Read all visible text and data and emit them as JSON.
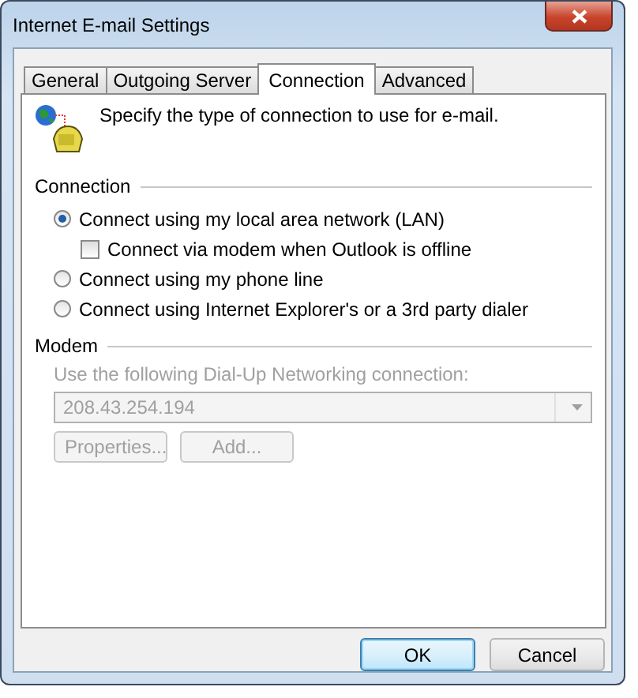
{
  "window": {
    "title": "Internet E-mail Settings"
  },
  "tabs": [
    {
      "label": "General",
      "selected": false
    },
    {
      "label": "Outgoing Server",
      "selected": false
    },
    {
      "label": "Connection",
      "selected": true
    },
    {
      "label": "Advanced",
      "selected": false
    }
  ],
  "header": {
    "text": "Specify the type of connection to use for e-mail."
  },
  "connection": {
    "label": "Connection",
    "options": [
      {
        "kind": "radio",
        "label": "Connect using my local area network (LAN)",
        "checked": true,
        "children": [
          {
            "kind": "checkbox",
            "label": "Connect via modem when Outlook is offline",
            "checked": false
          }
        ]
      },
      {
        "kind": "radio",
        "label": "Connect using my phone line",
        "checked": false
      },
      {
        "kind": "radio",
        "label": "Connect using Internet Explorer's or a 3rd party dialer",
        "checked": false
      }
    ]
  },
  "modem": {
    "label": "Modem",
    "disabled": true,
    "field_label": "Use the following Dial-Up Networking connection:",
    "dropdown": {
      "value": "208.43.254.194"
    },
    "buttons": [
      "Properties...",
      "Add..."
    ]
  },
  "buttons": [
    {
      "label": "OK",
      "default": true
    },
    {
      "label": "Cancel",
      "default": false
    }
  ]
}
